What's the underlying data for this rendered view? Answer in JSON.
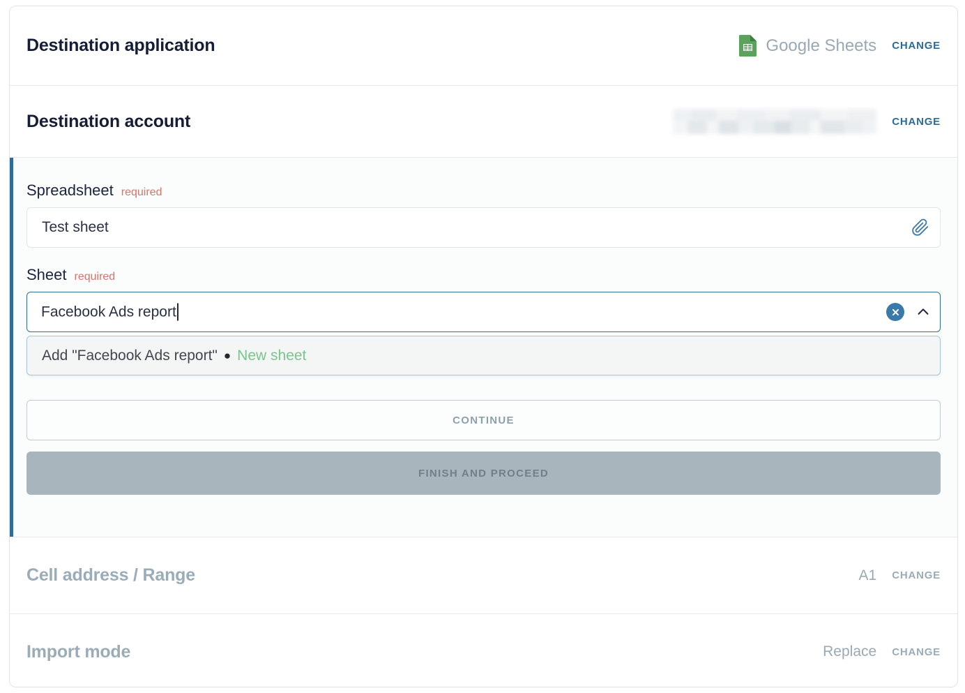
{
  "sections": {
    "destination_application": {
      "title": "Destination application",
      "app_name": "Google Sheets",
      "app_icon": "google-sheets-icon",
      "change_label": "CHANGE"
    },
    "destination_account": {
      "title": "Destination account",
      "value": "",
      "value_state": "redacted",
      "change_label": "CHANGE"
    },
    "cell_address_range": {
      "title": "Cell address / Range",
      "value": "A1",
      "change_label": "CHANGE",
      "state": "disabled"
    },
    "import_mode": {
      "title": "Import mode",
      "value": "Replace",
      "change_label": "CHANGE",
      "state": "disabled"
    }
  },
  "active_form": {
    "spreadsheet": {
      "label": "Spreadsheet",
      "required_label": "required",
      "value": "Test sheet",
      "placeholder": "",
      "attach_icon": "paperclip-icon"
    },
    "sheet": {
      "label": "Sheet",
      "required_label": "required",
      "value": "Facebook Ads report",
      "placeholder": "",
      "clear_icon": "clear-circle-icon",
      "collapse_icon": "chevron-up-icon",
      "suggestion": {
        "prefix": "Add \"Facebook Ads report\"",
        "separator": "●",
        "tag": "New sheet"
      }
    },
    "buttons": {
      "continue": "CONTINUE",
      "finish": "FINISH AND PROCEED"
    }
  },
  "colors": {
    "accent_blue": "#2f6d99",
    "link_blue": "#2d6b96",
    "required_red": "#d9736a",
    "new_sheet_green": "#7bc58d",
    "google_sheets_green": "#5ba35c",
    "muted_text": "#9aacb8",
    "title_dark": "#161d37",
    "disabled_button": "#a8b5bd"
  }
}
